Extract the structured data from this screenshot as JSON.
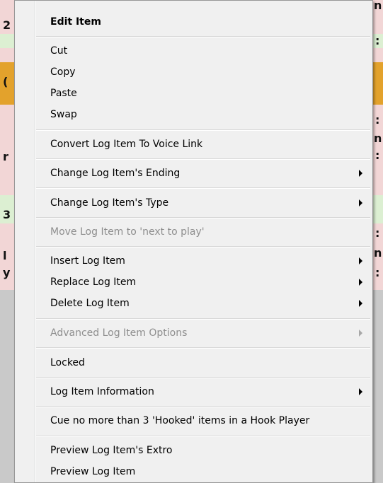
{
  "menu": {
    "items": [
      {
        "label": "Edit Item"
      },
      {
        "label": "Cut"
      },
      {
        "label": "Copy"
      },
      {
        "label": "Paste"
      },
      {
        "label": "Swap"
      },
      {
        "label": "Convert Log Item To Voice Link"
      },
      {
        "label": "Change Log Item's Ending"
      },
      {
        "label": "Change Log Item's Type"
      },
      {
        "label": "Move Log Item to 'next to play'"
      },
      {
        "label": "Insert Log Item"
      },
      {
        "label": "Replace Log Item"
      },
      {
        "label": "Delete Log Item"
      },
      {
        "label": "Advanced Log Item Options"
      },
      {
        "label": "Locked"
      },
      {
        "label": "Log Item Information"
      },
      {
        "label": "Cue no more than 3 'Hooked' items in a Hook Player"
      },
      {
        "label": "Preview Log Item's Extro"
      },
      {
        "label": "Preview Log Item"
      }
    ]
  },
  "background": {
    "left_glyphs": [
      "2",
      "(",
      "r",
      "3",
      "l",
      "y"
    ],
    "right_glyphs": [
      "n:",
      ":",
      ":",
      "n",
      ":",
      ":",
      "n",
      ":"
    ]
  },
  "colors": {
    "menu_bg": "#f0f0f0",
    "disabled_text": "#8e8e8e",
    "row_pink": "#f2d6d6",
    "row_green": "#dcefd2",
    "row_orange": "#e3a22c"
  }
}
